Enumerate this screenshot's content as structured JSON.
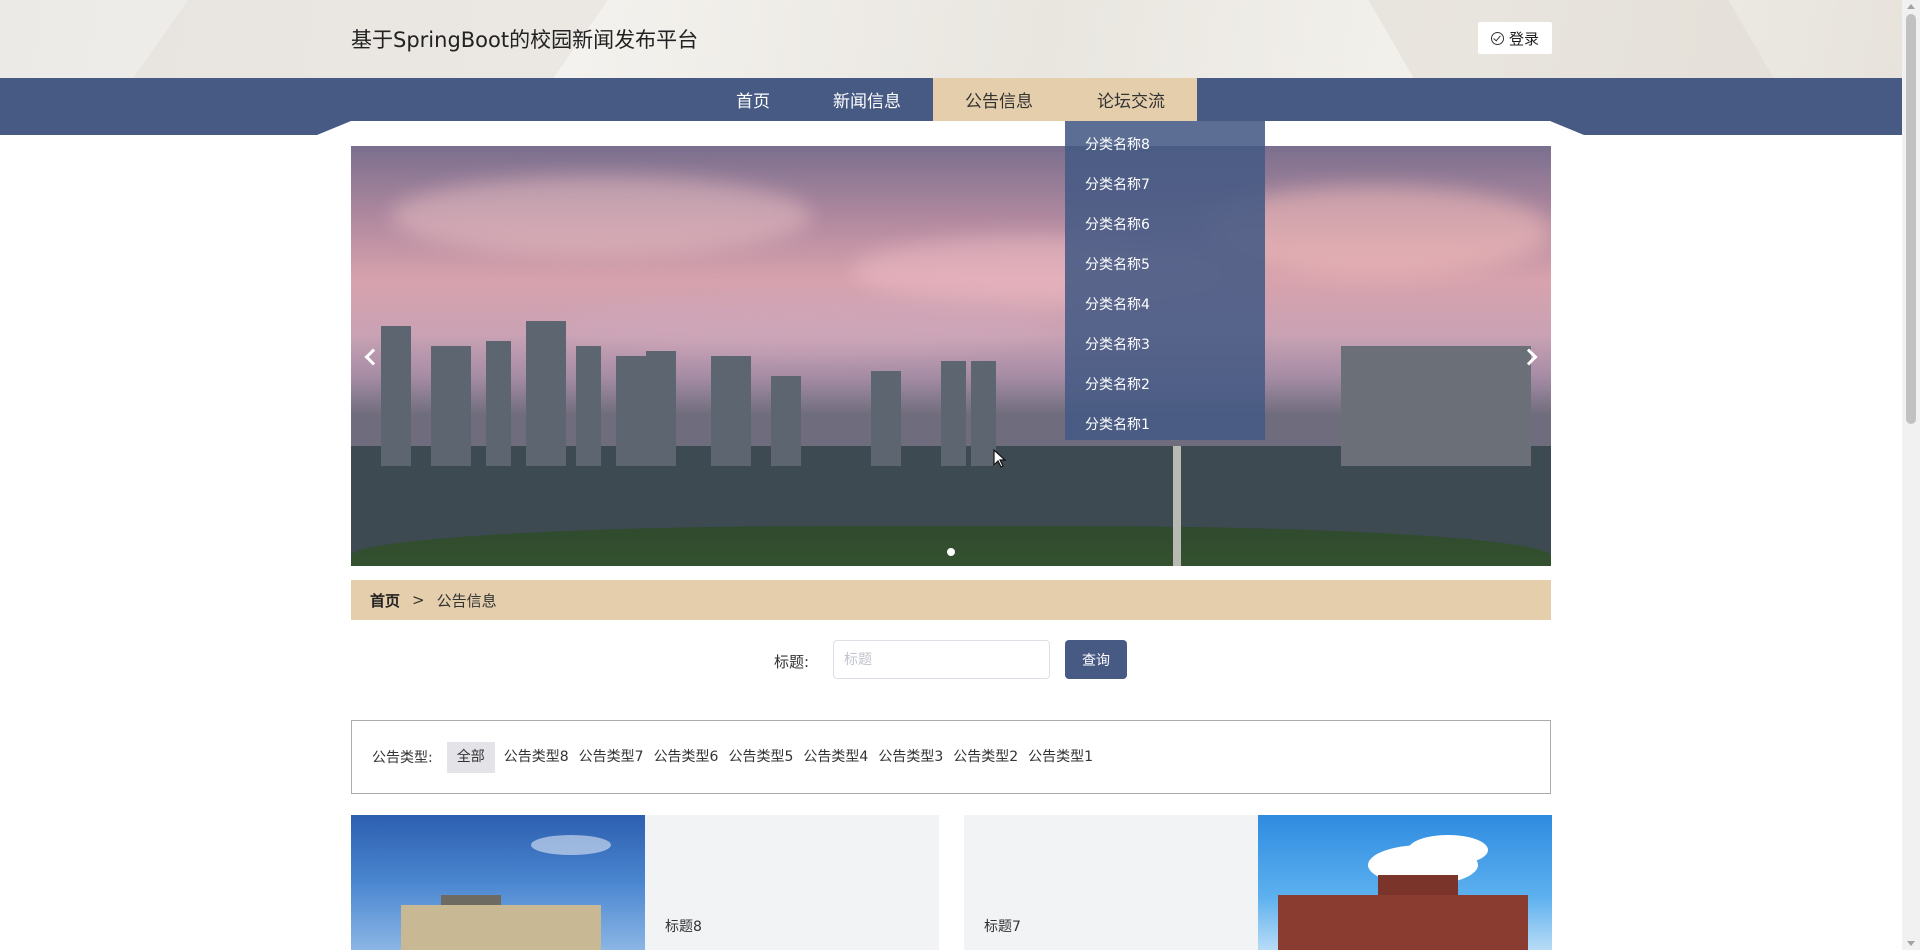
{
  "header": {
    "site_title": "基于SpringBoot的校园新闻发布平台",
    "login_label": "登录"
  },
  "nav": {
    "items": [
      {
        "label": "首页"
      },
      {
        "label": "新闻信息"
      },
      {
        "label": "公告信息"
      },
      {
        "label": "论坛交流"
      }
    ],
    "active_index": 2
  },
  "dropdown": {
    "items": [
      "分类名称8",
      "分类名称7",
      "分类名称6",
      "分类名称5",
      "分类名称4",
      "分类名称3",
      "分类名称2",
      "分类名称1"
    ]
  },
  "breadcrumb": {
    "home": "首页",
    "separator": ">",
    "current": "公告信息"
  },
  "search": {
    "label": "标题:",
    "placeholder": "标题",
    "value": "",
    "button_label": "查询"
  },
  "filter": {
    "label": "公告类型:",
    "items": [
      "全部",
      "公告类型8",
      "公告类型7",
      "公告类型6",
      "公告类型5",
      "公告类型4",
      "公告类型3",
      "公告类型2",
      "公告类型1"
    ],
    "active_index": 0
  },
  "cards": [
    {
      "title": "标题8"
    },
    {
      "title": "标题7"
    }
  ],
  "colors": {
    "nav_bg": "#465a84",
    "accent": "#e4ceac",
    "button": "#465a84"
  }
}
